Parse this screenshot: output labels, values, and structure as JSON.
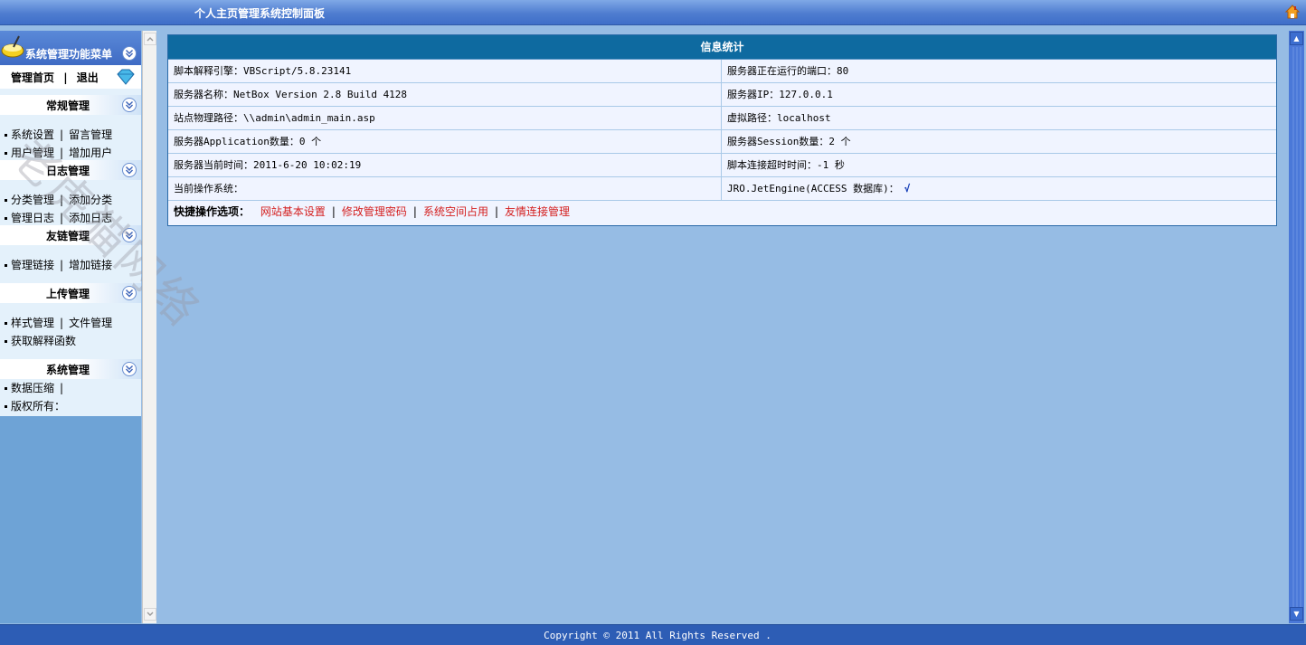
{
  "header": {
    "title": "个人主页管理系统控制面板",
    "home_icon": "home-icon"
  },
  "sidebar": {
    "menu_title": "系统管理功能菜单",
    "home_link": "管理首页",
    "separator": "|",
    "logout_link": "退出",
    "sections": [
      {
        "title": "常规管理",
        "rows": [
          [
            "系统设置",
            "留言管理"
          ],
          [
            "用户管理",
            "增加用户"
          ]
        ]
      },
      {
        "title": "日志管理",
        "rows": [
          [
            "分类管理",
            "添加分类"
          ],
          [
            "管理日志",
            "添加日志"
          ]
        ]
      },
      {
        "title": "友链管理",
        "rows": [
          [
            "管理链接",
            "增加链接"
          ]
        ]
      },
      {
        "title": "上传管理",
        "rows": [
          [
            "样式管理",
            "文件管理"
          ],
          [
            "获取解释函数"
          ]
        ]
      },
      {
        "title": "系统管理",
        "rows": [
          [
            "数据压缩"
          ],
          [
            "版权所有："
          ]
        ]
      }
    ],
    "watermark": "老虎猫网络"
  },
  "info": {
    "title": "信息统计",
    "rows": [
      {
        "left": "脚本解释引擎：VBScript/5.8.23141",
        "right": "服务器正在运行的端口：80"
      },
      {
        "left": "服务器名称：NetBox Version 2.8 Build 4128",
        "right": "服务器IP：127.0.0.1"
      },
      {
        "left": "站点物理路径：\\\\admin\\admin_main.asp",
        "right": "虚拟路径：localhost"
      },
      {
        "left": "服务器Application数量：0 个",
        "right": "服务器Session数量：2 个"
      },
      {
        "left": "服务器当前时间：2011-6-20 10:02:19",
        "right": "脚本连接超时时间：-1 秒"
      },
      {
        "left": "当前操作系统：",
        "right": "JRO.JetEngine(ACCESS 数据库)：",
        "right_check": "√"
      }
    ],
    "quick_label": "快捷操作选项：",
    "quick_links": [
      "网站基本设置",
      "修改管理密码",
      "系统空间占用",
      "友情连接管理"
    ],
    "quick_sep": "|"
  },
  "footer": {
    "text": "Copyright © 2011 All Rights Reserved ."
  }
}
